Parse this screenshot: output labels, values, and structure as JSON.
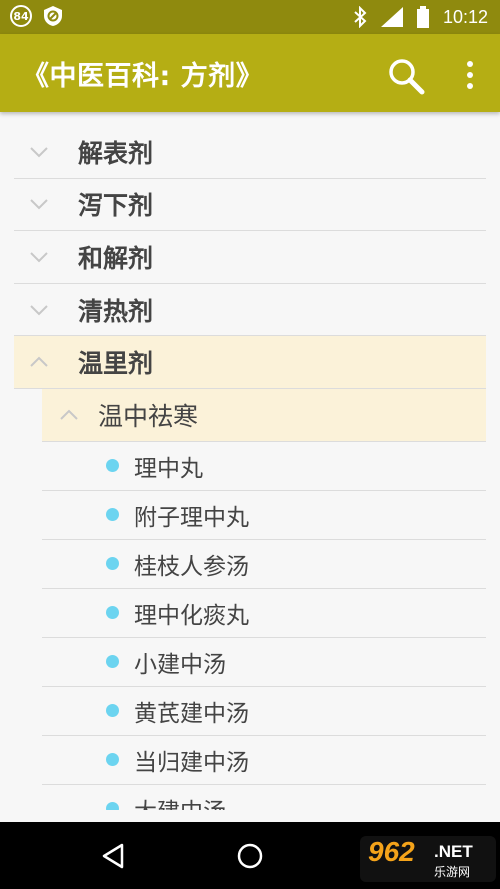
{
  "status_bar": {
    "badge_84": "84",
    "time": "10:12",
    "icons": [
      "bluetooth-icon",
      "signal-icon",
      "battery-icon"
    ]
  },
  "app_bar": {
    "title": "《中医百科: 方剂》",
    "color": "#b5ae14",
    "actions": [
      "search-icon",
      "more-vert-icon"
    ]
  },
  "tree": {
    "categories": [
      {
        "label": "解表剂",
        "expanded": false
      },
      {
        "label": "泻下剂",
        "expanded": false
      },
      {
        "label": "和解剂",
        "expanded": false
      },
      {
        "label": "清热剂",
        "expanded": false
      },
      {
        "label": "温里剂",
        "expanded": true
      }
    ],
    "subcategory": {
      "label": "温中祛寒",
      "expanded": true
    },
    "items": [
      "理中丸",
      "附子理中丸",
      "桂枝人参汤",
      "理中化痰丸",
      "小建中汤",
      "黄芪建中汤",
      "当归建中汤",
      "大建中汤"
    ]
  },
  "nav_bar": {
    "buttons": [
      "back-icon",
      "home-icon"
    ]
  },
  "watermark": {
    "big": "962",
    "net": ".NET",
    "small": "乐游网"
  }
}
